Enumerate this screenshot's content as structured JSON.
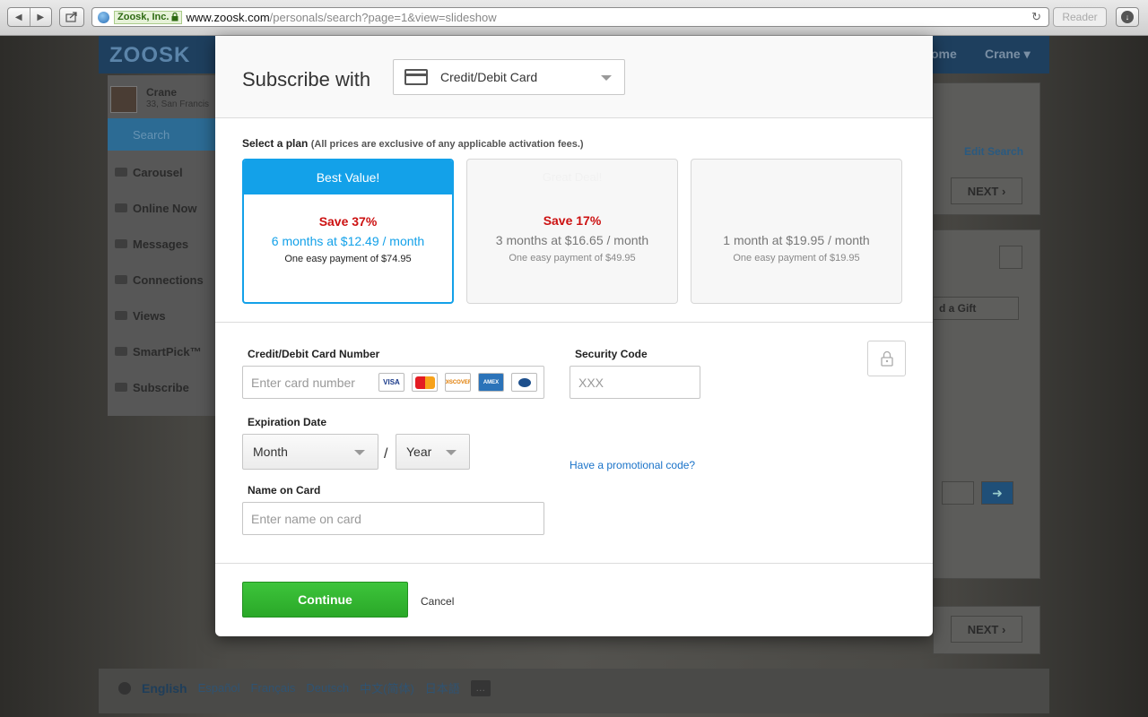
{
  "browser": {
    "identity": "Zoosk, Inc.",
    "url_host": "www.zoosk.com",
    "url_path": "/personals/search?page=1&view=slideshow",
    "reader_label": "Reader"
  },
  "background": {
    "logo": "ZOOSK",
    "nav_home": "ome",
    "nav_user": "Crane ▾",
    "profile_name": "Crane",
    "profile_location": "33, San Francis",
    "sidebar": [
      "Search",
      "Carousel",
      "Online Now",
      "Messages",
      "Connections",
      "Views",
      "SmartPick™",
      "Subscribe"
    ],
    "edit_search": "Edit Search",
    "next_label": "NEXT",
    "gift_label": "d a Gift",
    "languages": [
      "English",
      "Español",
      "Français",
      "Deutsch",
      "中文(简体)",
      "日本語"
    ],
    "lang_more": "…"
  },
  "modal": {
    "title": "Subscribe with",
    "payment_method": "Credit/Debit Card",
    "plan_label": "Select a plan",
    "plan_note": "(All prices are exclusive of any applicable activation fees.)",
    "plans": [
      {
        "banner": "Best Value!",
        "save": "Save 37%",
        "price": "6 months at $12.49 / month",
        "payment": "One easy payment of $74.95",
        "selected": true
      },
      {
        "banner": "Great Deal!",
        "save": "Save 17%",
        "price": "3 months at $16.65 / month",
        "payment": "One easy payment of $49.95",
        "selected": false
      },
      {
        "banner": "",
        "save": "",
        "price": "1 month at $19.95 / month",
        "payment": "One easy payment of $19.95",
        "selected": false
      }
    ],
    "card_number_label": "Credit/Debit Card Number",
    "card_number_placeholder": "Enter card number",
    "security_code_label": "Security Code",
    "security_code_placeholder": "XXX",
    "expiration_label": "Expiration Date",
    "month_label": "Month",
    "year_label": "Year",
    "separator": "/",
    "name_label": "Name on Card",
    "name_placeholder": "Enter name on card",
    "promo_link": "Have a promotional code?",
    "continue_label": "Continue",
    "cancel_label": "Cancel",
    "card_logos": [
      "VISA",
      "MasterCard",
      "DISCOVER",
      "AMERICAN EXPRESS",
      "Diners Club"
    ]
  },
  "colors": {
    "accent_blue": "#13a1e9",
    "save_red": "#cc1111",
    "continue_green": "#2aa828",
    "link_blue": "#1a73c9"
  }
}
